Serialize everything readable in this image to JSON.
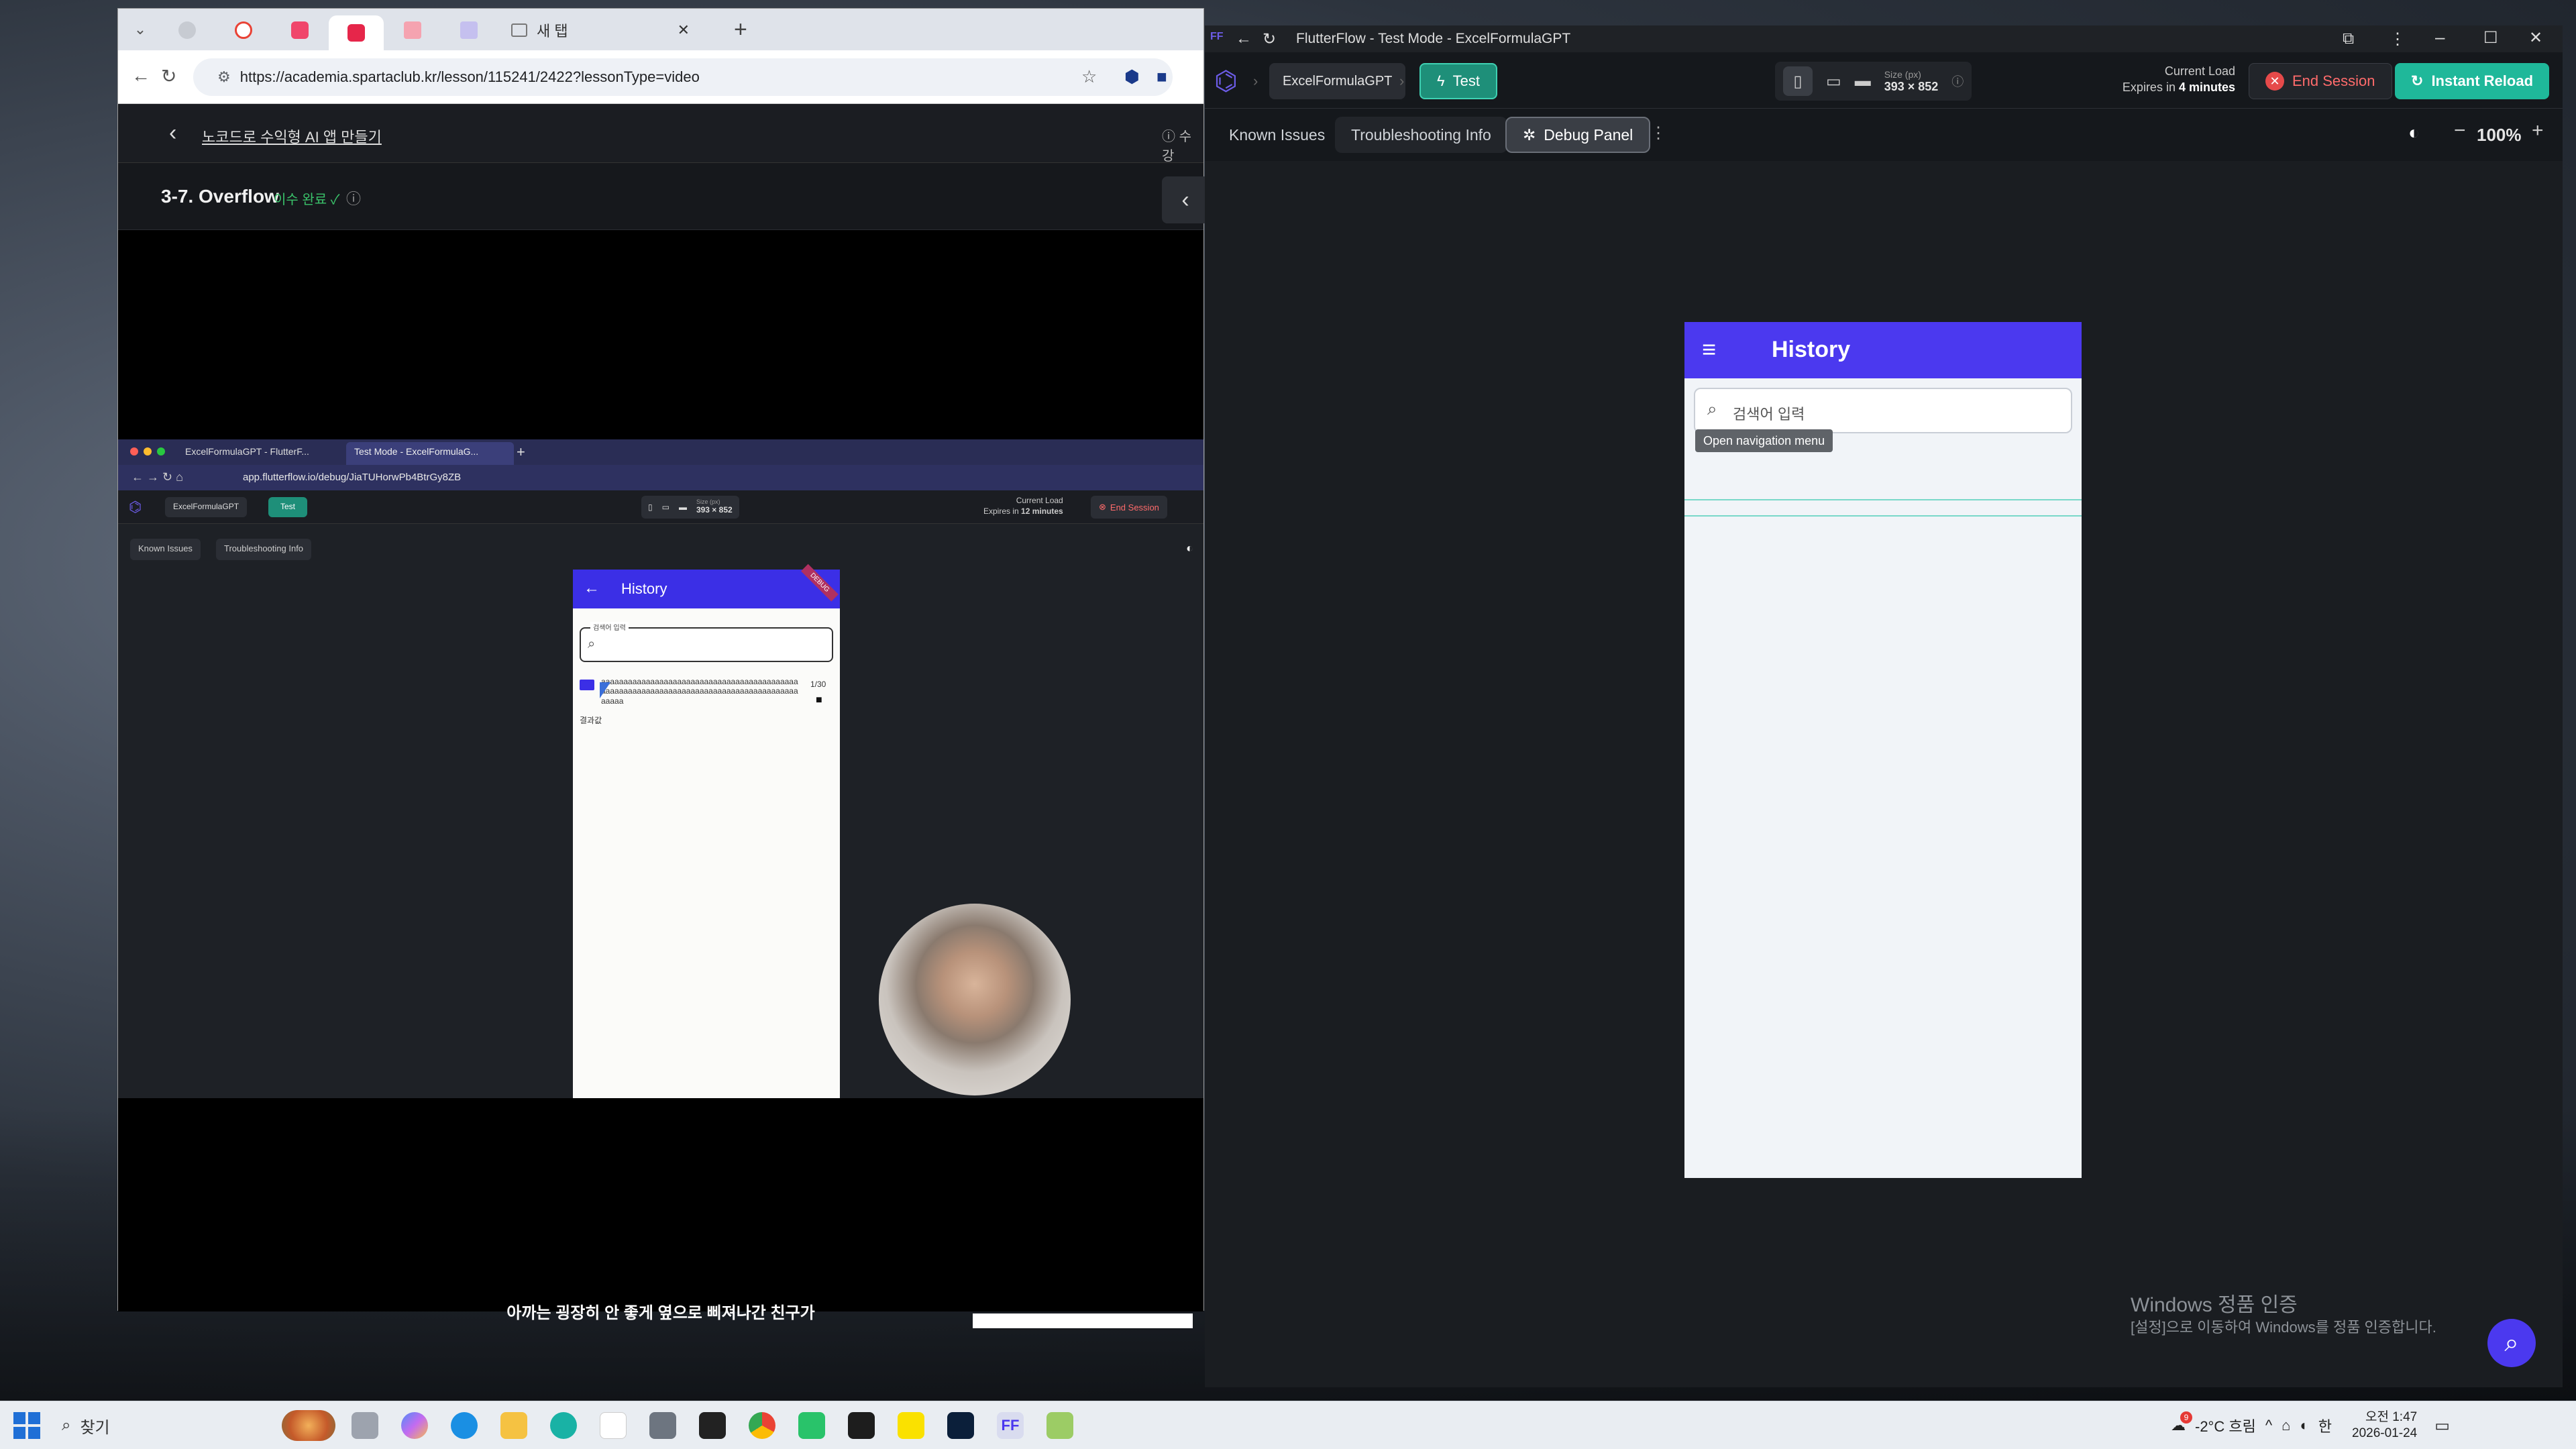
{
  "left_browser": {
    "new_tab_label": "새 탭",
    "url": "https://academia.spartaclub.kr/lesson/115241/2422?lessonType=video",
    "course_title": "노코드로 수익형 AI 앱 만들기",
    "header_right": "수강",
    "lesson_title": "3-7. Overflow",
    "lesson_status": "이수 완료 ✓",
    "inner": {
      "tab1": "ExcelFormulaGPT - FlutterF...",
      "tab2": "Test Mode - ExcelFormulaG...",
      "url": "app.flutterflow.io/debug/JiaTUHorwPb4BtrGy8ZB",
      "project": "ExcelFormulaGPT",
      "test": "Test",
      "size_label": "Size (px)",
      "size_value": "393 × 852",
      "current_load": "Current Load",
      "expires_prefix": "Expires in",
      "expires_value": "12 minutes",
      "end_session": "End Session",
      "known_issues": "Known Issues",
      "troubleshooting": "Troubleshooting Info",
      "phone_title": "History",
      "debug_ribbon": "DEBUG",
      "search_label": "검색어 입력",
      "item_text": "aaaaaaaaaaaaaaaaaaaaaaaaaaaaaaaaaaaaaaaaaaaaaaaaaaaaaaaaaaaaaaaaaaaaaaaaaaaaaaaaaaaaaaaaaaaaa",
      "item_count": "1/30",
      "result_text": "결과값"
    },
    "subtitle": "아까는 굉장히 안 좋게 옆으로 삐져나간 친구가"
  },
  "right_window": {
    "title": "FlutterFlow - Test Mode - ExcelFormulaGPT",
    "logo_letters": "FF",
    "project": "ExcelFormulaGPT",
    "test": "Test",
    "size_label": "Size (px)",
    "size_value": "393 × 852",
    "current_load": "Current Load",
    "expires_prefix": "Expires in",
    "expires_value": "4 minutes",
    "end_session": "End Session",
    "instant_reload": "Instant Reload",
    "tabs": {
      "known_issues": "Known Issues",
      "troubleshooting": "Troubleshooting Info",
      "debug_panel": "Debug Panel"
    },
    "zoom": "100%",
    "phone": {
      "title": "History",
      "search_placeholder": "검색어 입력",
      "tooltip": "Open navigation menu"
    },
    "watermark_line1": "Windows 정품 인증",
    "watermark_line2": "[설정]으로 이동하여 Windows를 정품 인증합니다."
  },
  "taskbar": {
    "search": "찾기",
    "weather": "-2°C 흐림",
    "weather_badge": "9",
    "ime": "한",
    "time": "오전 1:47",
    "date": "2026-01-24"
  },
  "colors": {
    "brand": "#4b39ef",
    "teal": "#1fb89a",
    "end_red": "#e64a4a"
  }
}
